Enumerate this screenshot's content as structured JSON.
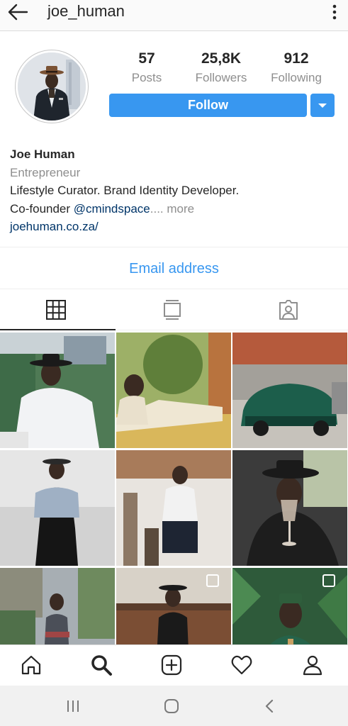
{
  "topbar": {
    "username": "joe_human",
    "back_icon": "back-arrow-icon",
    "more_icon": "more-vertical-icon"
  },
  "profile": {
    "stats": [
      {
        "value": "57",
        "label": "Posts"
      },
      {
        "value": "25,8K",
        "label": "Followers"
      },
      {
        "value": "912",
        "label": "Following"
      }
    ],
    "follow_label": "Follow"
  },
  "bio": {
    "name": "Joe Human",
    "category": "Entrepreneur",
    "line1": "Lifestyle Curator.  Brand Identity Developer.",
    "line2_prefix": "Co-founder ",
    "mention": "@cmindspace",
    "ellipsis": "....",
    "more": " more",
    "link": "joehuman.co.za/"
  },
  "contact": {
    "email_label": "Email address"
  },
  "tabs": [
    {
      "icon": "grid-icon",
      "active": true
    },
    {
      "icon": "feed-list-icon",
      "active": false
    },
    {
      "icon": "tagged-photos-icon",
      "active": false
    }
  ],
  "bottom_nav": [
    "home-icon",
    "search-icon",
    "add-post-icon",
    "activity-heart-icon",
    "profile-icon"
  ],
  "system_nav": [
    "recent-apps-icon",
    "home-circle-icon",
    "back-chevron-icon"
  ],
  "colors": {
    "accent": "#3897f0",
    "link": "#003569",
    "muted": "#8e8e8e"
  }
}
